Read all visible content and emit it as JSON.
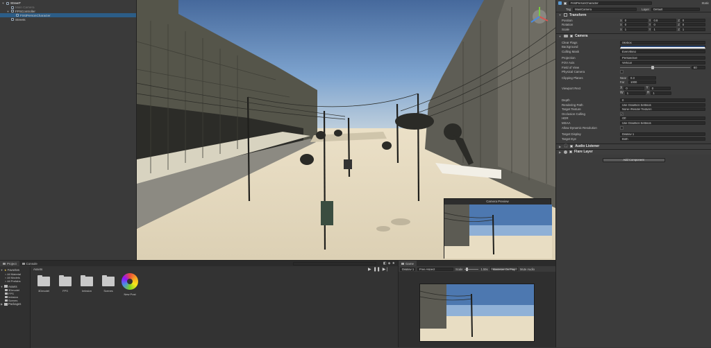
{
  "hierarchy": {
    "items": [
      {
        "label": "Street*",
        "depth": 0,
        "selected": false
      },
      {
        "label": "Main Camera",
        "depth": 1,
        "selected": false,
        "dim": true
      },
      {
        "label": "FPSController",
        "depth": 1,
        "selected": false
      },
      {
        "label": "FirstPersonCharacter",
        "depth": 2,
        "selected": true
      },
      {
        "label": "Streets",
        "depth": 1,
        "selected": false
      }
    ]
  },
  "inspector": {
    "object_name": "FirstPersonCharacter",
    "static_label": "Static",
    "tag_label": "Tag",
    "tag_value": "MainCamera",
    "layer_label": "Layer",
    "layer_value": "Default",
    "transform": {
      "title": "Transform",
      "rows": [
        {
          "label": "Position",
          "x": "0",
          "y": "0.8",
          "z": "0"
        },
        {
          "label": "Rotation",
          "x": "0",
          "y": "0",
          "z": "0"
        },
        {
          "label": "Scale",
          "x": "1",
          "y": "1",
          "z": "1"
        }
      ]
    },
    "camera": {
      "title": "Camera",
      "clear_flags": {
        "label": "Clear Flags",
        "value": "Skybox"
      },
      "background": {
        "label": "Background"
      },
      "culling_mask": {
        "label": "Culling Mask",
        "value": "Everything"
      },
      "projection": {
        "label": "Projection",
        "value": "Perspective"
      },
      "fov_axis": {
        "label": "FOV Axis",
        "value": "Vertical"
      },
      "field_of_view": {
        "label": "Field of View",
        "value": "60",
        "fraction": 0.45
      },
      "physical_camera": {
        "label": "Physical Camera"
      },
      "clipping_planes": {
        "label": "Clipping Planes",
        "near_label": "Near",
        "near": "0.3",
        "far_label": "Far",
        "far": "1000"
      },
      "viewport_rect": {
        "label": "Viewport Rect",
        "x": "0",
        "y": "0",
        "w": "1",
        "h": "1"
      },
      "depth": {
        "label": "Depth",
        "value": "0"
      },
      "rendering_path": {
        "label": "Rendering Path",
        "value": "Use Graphics Settings"
      },
      "target_texture": {
        "label": "Target Texture",
        "value": "None (Render Texture)"
      },
      "occlusion_culling": {
        "label": "Occlusion Culling"
      },
      "hdr": {
        "label": "HDR",
        "value": "Off"
      },
      "msaa": {
        "label": "MSAA",
        "value": "Use Graphics Settings"
      },
      "dynamic_resolution": {
        "label": "Allow Dynamic Resolution"
      },
      "target_display": {
        "label": "Target Display",
        "value": "Display 1"
      },
      "target_eye": {
        "label": "Target Eye",
        "value": "Both"
      }
    },
    "audio_listener": "Audio Listener",
    "flare_layer": "Flare Layer",
    "add_component": "Add Component"
  },
  "scene": {
    "camera_preview_title": "Camera Preview"
  },
  "project": {
    "tabs": [
      "Project",
      "Console"
    ],
    "favorites_label": "Favorites",
    "favorites": [
      "All Material",
      "All Models",
      "All Prefabs"
    ],
    "assets_label": "Assets",
    "asset_tree": [
      "3Dmodel",
      "FPS",
      "Imbsion",
      "Scenes"
    ],
    "packages_label": "Packages",
    "breadcrumb": "Assets",
    "assets": [
      {
        "label": "3Dmodel",
        "icon": "folder-icon"
      },
      {
        "label": "FPS",
        "icon": "folder-icon"
      },
      {
        "label": "Imbsion",
        "icon": "folder-icon"
      },
      {
        "label": "Scenes",
        "icon": "folder-icon"
      },
      {
        "label": "New Post",
        "icon": "post-process-icon"
      }
    ]
  },
  "game": {
    "tab": "Game",
    "display": "Display 1",
    "aspect": "Free Aspect",
    "scale_label": "Scale",
    "scale_value": "1.59x",
    "maximize": "Maximize On Play",
    "mute": "Mute Audio"
  },
  "colors": {
    "selection": "#2c5d87",
    "sky_top": "#5a85b8",
    "ground": "#e6dcc3"
  }
}
